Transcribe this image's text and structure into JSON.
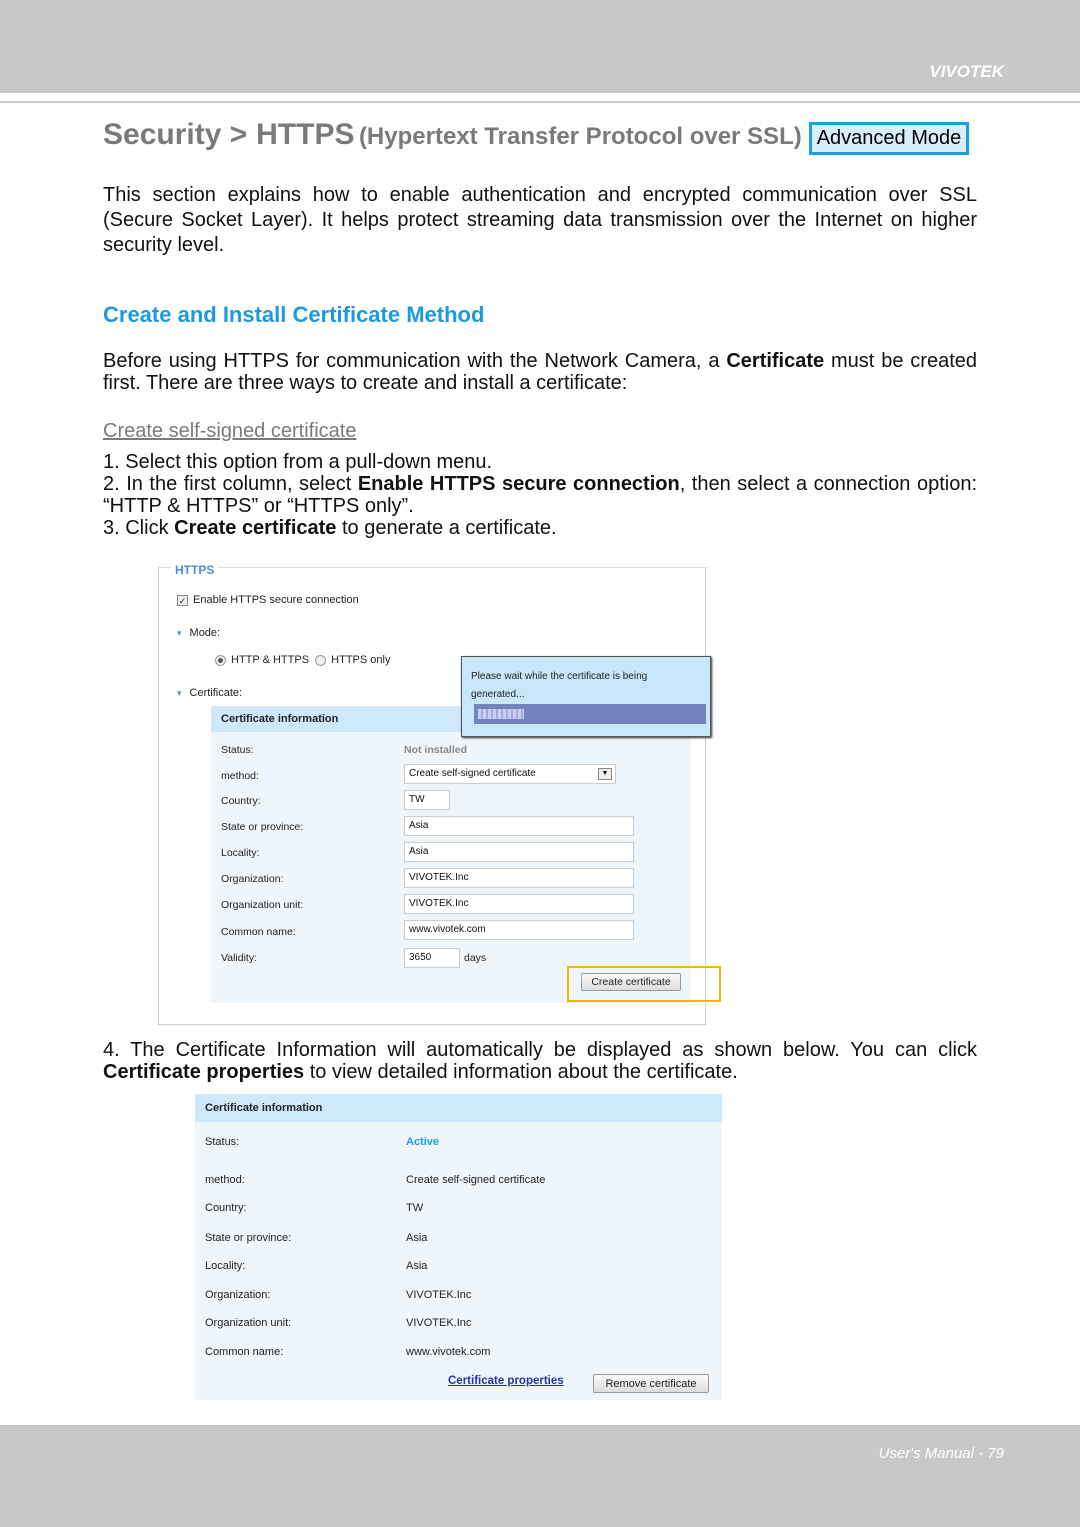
{
  "header": {
    "brand": "VIVOTEK"
  },
  "footer": {
    "page": "User's Manual - 79"
  },
  "title": {
    "section": "Security >",
    "page": "HTTPS",
    "subtitle": "(Hypertext Transfer Protocol over SSL)",
    "mode_badge": "Advanced Mode"
  },
  "intro": "This section explains how to enable authentication and encrypted communication over SSL (Secure Socket Layer). It helps protect streaming data transmission over the Internet on higher security level.",
  "method_heading": "Create and Install Certificate Method",
  "method_para": {
    "a": "Before using HTTPS for communication with the Network Camera, a ",
    "b": "Certificate",
    "c": " must be created first. There are three ways to create and install a certificate:"
  },
  "sub_heading": "Create self-signed certificate",
  "steps": {
    "s1": "1. Select this option from a pull-down menu.",
    "s2a": "2. In the first column, select ",
    "s2b": "Enable HTTPS secure connection",
    "s2c": ", then select a connection option: “HTTP & HTTPS” or “HTTPS only”.",
    "s3a": "3. Click ",
    "s3b": "Create certificate",
    "s3c": " to generate a certificate.",
    "s4a": "4. The Certificate Information will automatically be displayed as shown below. You can click ",
    "s4b": "Certifi­cate properties",
    "s4c": " to view detailed information about the certificate."
  },
  "shot1": {
    "legend": "HTTPS",
    "enable_label": "Enable HTTPS secure connection",
    "enable_checked": true,
    "mode_label": "Mode:",
    "mode_options": [
      "HTTP & HTTPS",
      "HTTPS only"
    ],
    "mode_selected": "HTTP & HTTPS",
    "cert_label": "Certificate:",
    "panel_title": "Certificate information",
    "popup_text": "Please wait while the certificate is being generated...",
    "popup_progress_percent": 20,
    "labels": [
      "Status:",
      "method:",
      "Country:",
      "State or province:",
      "Locality:",
      "Organization:",
      "Organization unit:",
      "Common name:",
      "Validity:"
    ],
    "status": "Not installed",
    "method": "Create self-signed certificate",
    "country": "TW",
    "state": "Asia",
    "locality": "Asia",
    "organization": "VIVOTEK.Inc",
    "org_unit": "VIVOTEK.Inc",
    "common_name": "www.vivotek.com",
    "validity": "3650",
    "validity_unit": "days",
    "create_button": "Create certificate"
  },
  "shot2": {
    "panel_title": "Certificate information",
    "labels": [
      "Status:",
      "method:",
      "Country:",
      "State or province:",
      "Locality:",
      "Organization:",
      "Organization unit:",
      "Common name:"
    ],
    "values": [
      "Active",
      "Create self-signed certificate",
      "TW",
      "Asia",
      "Asia",
      "VIVOTEK.Inc",
      "VIVOTEK.Inc",
      "www.vivotek.com"
    ],
    "status_color": "#1a9be0",
    "properties_link": "Certificate properties",
    "remove_button": "Remove certificate"
  }
}
